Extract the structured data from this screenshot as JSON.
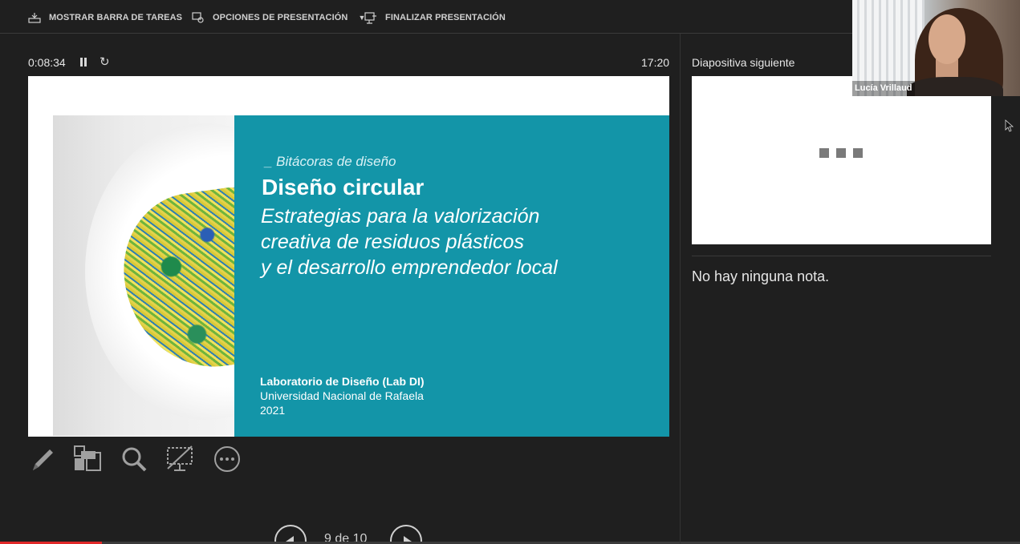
{
  "toolbar": {
    "taskbar_label": "MOSTRAR BARRA DE TAREAS",
    "options_label": "OPCIONES DE PRESENTACIÓN",
    "options_caret": "▼",
    "end_label": "FINALIZAR PRESENTACIÓN"
  },
  "presenter": {
    "elapsed_time": "0:08:34",
    "clock": "17:20",
    "pause_icon": "pause-icon",
    "reset_icon": "↻"
  },
  "slide": {
    "kicker": "_ Bitácoras de diseño",
    "title": "Diseño circular",
    "subtitle_lines": [
      "Estrategias para la valorización",
      "creativa de residuos plásticos",
      "y el desarrollo emprendedor local"
    ],
    "footer_lines": [
      "Laboratorio de Diseño (Lab DI)",
      "Universidad Nacional de Rafaela",
      "2021"
    ],
    "panel_color": "#1395a8"
  },
  "tools": [
    "pen-icon",
    "slides-grid-icon",
    "zoom-icon",
    "black-screen-icon",
    "more-options-icon"
  ],
  "navigation": {
    "page_label": "9 de 10",
    "progress": 0.1
  },
  "next_slide": {
    "label": "Diapositiva siguiente"
  },
  "notes": {
    "text": "No hay ninguna nota."
  },
  "webcam": {
    "name": "Lucía Vrillaud"
  },
  "colors": {
    "background": "#1f1f1f",
    "accent_red": "#e02828"
  }
}
